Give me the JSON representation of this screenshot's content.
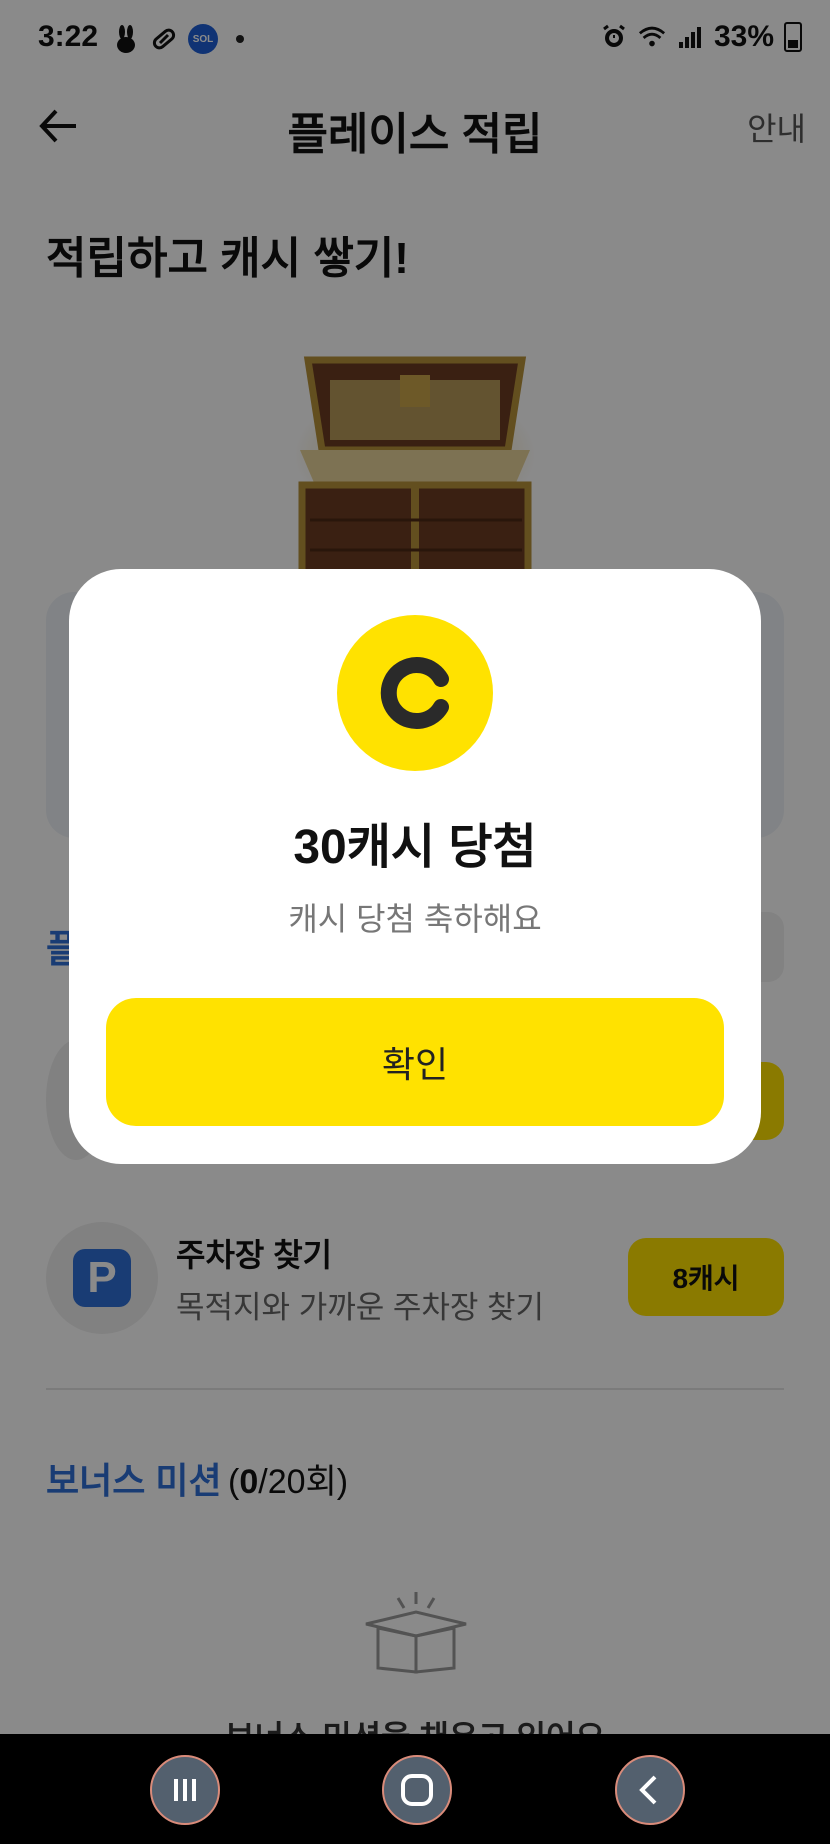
{
  "status_bar": {
    "time": "3:22",
    "sol_badge_text": "SOL",
    "battery": "33%"
  },
  "header": {
    "title": "플레이스 적립",
    "info_label": "안내",
    "back_icon": "arrow-left-icon"
  },
  "main": {
    "section_title": "적립하고 캐시 쌓기!",
    "partial_title": "플",
    "mission": {
      "title": "주차장 찾기",
      "subtitle": "목적지와 가까운 주차장 찾기",
      "cash_label": "8캐시",
      "icon": "parking-icon",
      "icon_letter": "P"
    },
    "bonus": {
      "title": "보너스 미션",
      "count_open": "(",
      "count_current": "0",
      "count_rest": "/20회)",
      "empty_text": "보너스 미션을 채우고 있어요"
    }
  },
  "modal": {
    "icon": "cash-coin-icon",
    "title": "30캐시 당첨",
    "subtitle": "캐시 당첨 축하해요",
    "confirm_label": "확인"
  },
  "colors": {
    "accent_yellow": "#ffe200",
    "accent_blue": "#2f6fd6"
  }
}
